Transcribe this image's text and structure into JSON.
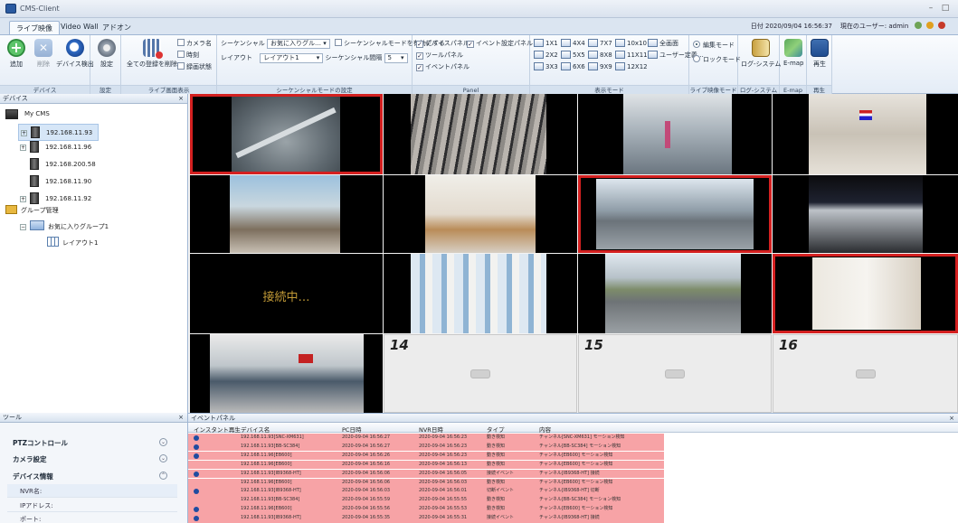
{
  "window": {
    "title": "CMS-Client",
    "min_glyph": "–",
    "max_glyph": "□"
  },
  "tabs": [
    {
      "label": "ライブ映像",
      "active": true
    },
    {
      "label": "Video Wall",
      "active": false
    },
    {
      "label": "アドオン",
      "active": false
    }
  ],
  "status": {
    "date_label": "日付",
    "date_value": "2020/09/04 16:56:37",
    "user_label": "現在のユーザー: admin"
  },
  "ribbon": {
    "device_group": {
      "label": "デバイス",
      "add": "追加",
      "delete": "削除",
      "detect": "デバイス検出"
    },
    "settings_group": {
      "label": "設定",
      "settings": "設定"
    },
    "live_display_group": {
      "label": "ライブ画面表示",
      "delete_all": "全ての登録を削除",
      "camera_name": "カメラ名",
      "time": "時刻",
      "recording_status": "録画状態"
    },
    "sequence_group": {
      "label": "シーケンシャルモードの設定",
      "seq_label": "シーケンシャル",
      "favorites_combo": "お気に入りグル…",
      "enable_seq": "シーケンシャルモードを有効にする",
      "layout_label": "レイアウト",
      "layout_combo": "レイアウト1",
      "interval_label": "シーケンシャル間隔",
      "interval_value": "5"
    },
    "panel_group": {
      "label": "Panel",
      "device_panel": "デバイスパネル",
      "event_settings_panel": "イベント設定パネル",
      "tool_panel": "ツールパネル",
      "event_panel": "イベントパネル"
    },
    "display_mode_group": {
      "label": "表示モード",
      "modes": [
        "1X1",
        "4X4",
        "7X7",
        "10x10",
        "全画面",
        "2X2",
        "5X5",
        "8X8",
        "11X11",
        "ユーザー定義…",
        "3X3",
        "6X6",
        "9X9",
        "12X12"
      ]
    },
    "live_mode_group": {
      "label": "ライブ映像モード",
      "edit_mode": "編集モード",
      "lock_mode": "ロックモード",
      "selected": "edit"
    },
    "log_group": {
      "label": "ログ-システム",
      "log_system": "ログ-システム"
    },
    "emap_group": {
      "label": "E-map",
      "emap": "E-map"
    },
    "playback_group": {
      "label": "再生",
      "playback": "再生"
    }
  },
  "device_panel": {
    "title": "デバイス",
    "root": "My CMS",
    "devices": [
      "192.168.11.93",
      "192.168.11.96",
      "192.168.200.58",
      "192.168.11.90",
      "192.168.11.92"
    ],
    "group_management": "グループ管理",
    "favorite_group": "お気に入りグループ1",
    "layout": "レイアウト1"
  },
  "tool_panel": {
    "title": "ツール",
    "sections": [
      "PTZコントロール",
      "カメラ設定",
      "デバイス情報"
    ],
    "fields": [
      "NVR名:",
      "IPアドレス:",
      "ポート:"
    ]
  },
  "video_grid": {
    "connecting_text": "接続中…",
    "empty_cells": [
      "14",
      "15",
      "16"
    ]
  },
  "event_panel": {
    "title": "イベントパネル",
    "columns": [
      "インスタント再生",
      "デバイス名",
      "PC日時",
      "NVR日時",
      "タイプ",
      "内容"
    ],
    "rows": [
      {
        "device": "192.168.11.93[SNC-XM631]",
        "pc": "2020-09-04 16:56:27",
        "nvr": "2020-09-04 16:56:23",
        "type": "動き検知",
        "content": "チャンネル[SNC-XM631] モーション検知"
      },
      {
        "device": "192.168.11.93[BB-SC384]",
        "pc": "2020-09-04 16:56:27",
        "nvr": "2020-09-04 16:56:23",
        "type": "動き検知",
        "content": "チャンネル[BB-SC384] モーション検知"
      },
      {
        "device": "192.168.11.96[EB600]",
        "pc": "2020-09-04 16:56:26",
        "nvr": "2020-09-04 16:56:23",
        "type": "動き検知",
        "content": "チャンネル[EB600] モーション検知"
      },
      {
        "device": "192.168.11.96[EB600]",
        "pc": "2020-09-04 16:56:16",
        "nvr": "2020-09-04 16:56:13",
        "type": "動き検知",
        "content": "チャンネル[EB600] モーション検知"
      },
      {
        "device": "192.168.11.93[IB9368-HT]",
        "pc": "2020-09-04 16:56:06",
        "nvr": "2020-09-04 16:56:05",
        "type": "接続イベント",
        "content": "チャンネル[IB9368-HT] 接続"
      },
      {
        "device": "192.168.11.96[EB600]",
        "pc": "2020-09-04 16:56:06",
        "nvr": "2020-09-04 16:56:03",
        "type": "動き検知",
        "content": "チャンネル[EB600] モーション検知"
      },
      {
        "device": "192.168.11.93[IB9368-HT]",
        "pc": "2020-09-04 16:56:03",
        "nvr": "2020-09-04 16:56:01",
        "type": "切断イベント",
        "content": "チャンネル[IB9368-HT] 切断"
      },
      {
        "device": "192.168.11.93[BB-SC384]",
        "pc": "2020-09-04 16:55:59",
        "nvr": "2020-09-04 16:55:55",
        "type": "動き検知",
        "content": "チャンネル[BB-SC384] モーション検知"
      },
      {
        "device": "192.168.11.96[EB600]",
        "pc": "2020-09-04 16:55:56",
        "nvr": "2020-09-04 16:55:53",
        "type": "動き検知",
        "content": "チャンネル[EB600] モーション検知"
      },
      {
        "device": "192.168.11.93[IB9368-HT]",
        "pc": "2020-09-04 16:55:35",
        "nvr": "2020-09-04 16:55:31",
        "type": "接続イベント",
        "content": "チャンネル[IB9368-HT] 接続"
      }
    ]
  },
  "colors": {
    "ribbon_accent": "#2a5aa0",
    "selected_cell_border": "#d42020",
    "event_row_bg": "#f7a3a6",
    "connecting_text": "#c29a36"
  }
}
